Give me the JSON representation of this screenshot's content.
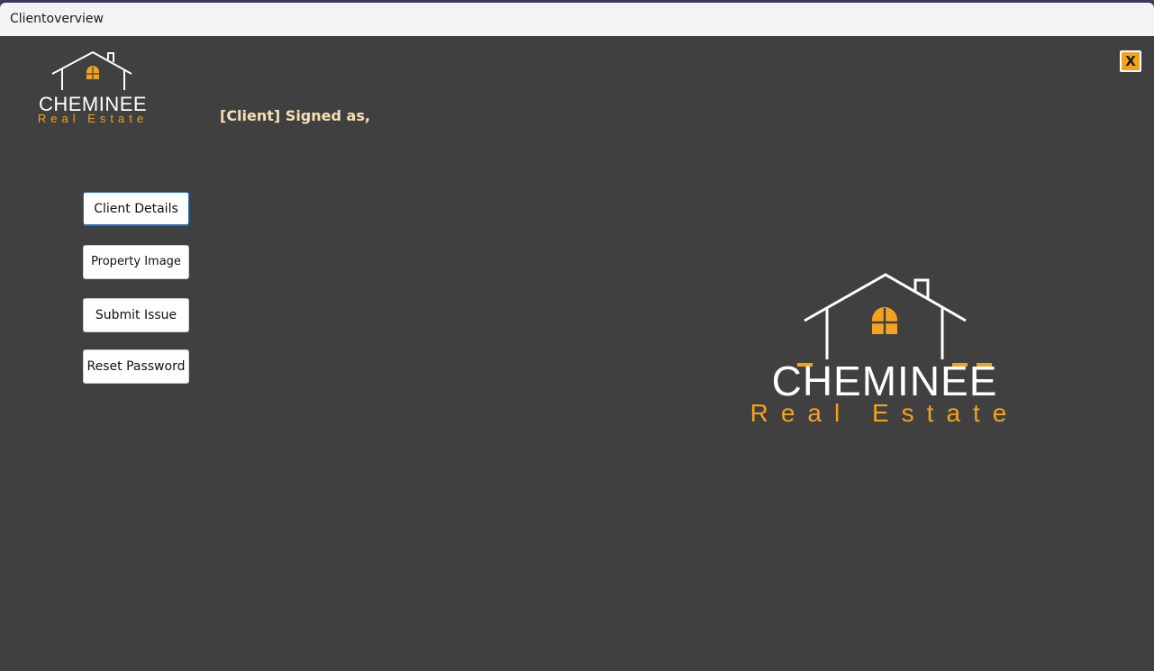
{
  "window": {
    "title": "Clientoverview"
  },
  "header": {
    "signed_as": "[Client] Signed as,",
    "close_label": "X"
  },
  "logo": {
    "name": "CHEMINEE",
    "tagline": "Real Estate"
  },
  "nav": {
    "client_details": "Client Details",
    "property_image": "Property Image",
    "submit_issue": "Submit Issue",
    "reset_password": "Reset Password"
  },
  "colors": {
    "background": "#404040",
    "accent_orange": "#f2a21d",
    "signed_as_text": "#f5e1b5",
    "logo_white": "#ffffff"
  }
}
